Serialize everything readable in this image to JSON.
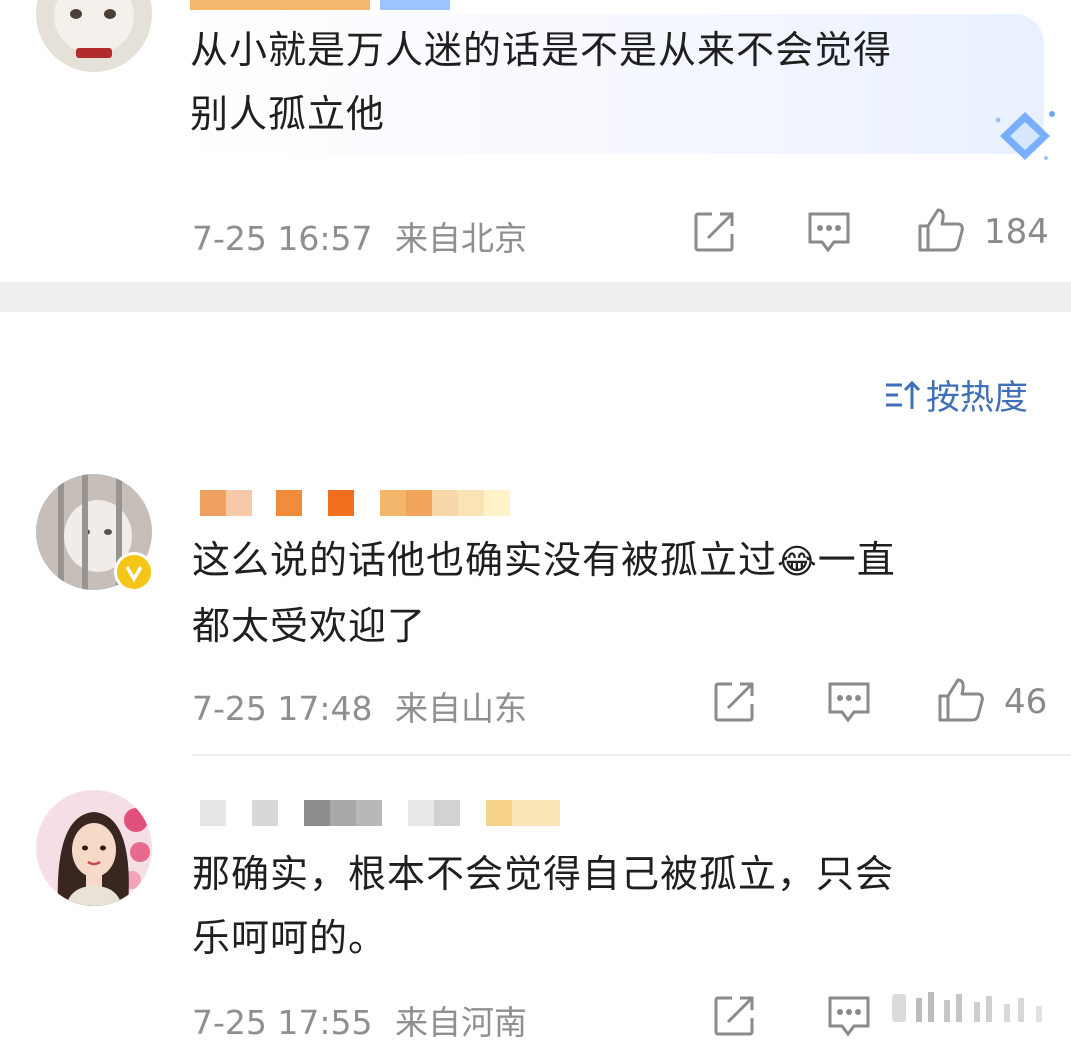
{
  "comments": [
    {
      "text_line1": "从小就是万人迷的话是不是从来不会觉得",
      "text_line2": "别人孤立他",
      "time": "7-25 16:57",
      "location": "来自北京",
      "likes": "184"
    },
    {
      "text_line1": "这么说的话他也确实没有被孤立过",
      "emoji": "😂",
      "text_line1b": "一直",
      "text_line2": "都太受欢迎了",
      "time": "7-25 17:48",
      "location": "来自山东",
      "likes": "46"
    },
    {
      "text_line1": "那确实，根本不会觉得自己被孤立，只会",
      "text_line2": "乐呵呵的。",
      "time": "7-25 17:55",
      "location": "来自河南",
      "likes": ""
    }
  ],
  "sort": {
    "label": "按热度",
    "icon": "sort-icon"
  },
  "icons": {
    "share": "share-icon",
    "reply": "comment-icon",
    "like": "thumbs-up-icon"
  },
  "colors": {
    "accent": "#3f6fb6",
    "meta": "#8f8f8f",
    "divider": "#efefef"
  }
}
